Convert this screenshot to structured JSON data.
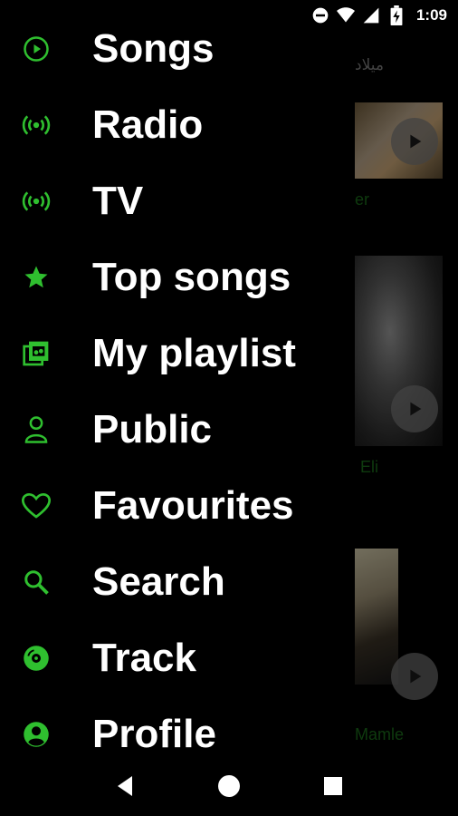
{
  "status_bar": {
    "time": "1:09",
    "icons": [
      "do-not-disturb-icon",
      "wifi-icon",
      "cellular-signal-icon",
      "battery-charging-icon"
    ]
  },
  "background": {
    "header_text": "میلاد",
    "captions": [
      "er",
      "Eli",
      "Mamle"
    ]
  },
  "drawer": {
    "items": [
      {
        "label": "Songs",
        "icon": "play-circle-icon"
      },
      {
        "label": "Radio",
        "icon": "radio-broadcast-icon"
      },
      {
        "label": "TV",
        "icon": "tv-broadcast-icon"
      },
      {
        "label": "Top songs",
        "icon": "star-icon"
      },
      {
        "label": "My playlist",
        "icon": "playlist-library-icon"
      },
      {
        "label": "Public",
        "icon": "person-outline-icon"
      },
      {
        "label": "Favourites",
        "icon": "heart-outline-icon"
      },
      {
        "label": "Search",
        "icon": "search-icon"
      },
      {
        "label": "Track",
        "icon": "disc-icon"
      },
      {
        "label": "Profile",
        "icon": "account-circle-icon"
      }
    ]
  },
  "nav_bar": {
    "icons": [
      "back-icon",
      "home-icon",
      "recents-icon"
    ]
  },
  "colors": {
    "accent": "#2fbf2f",
    "background": "#000000",
    "text": "#ffffff"
  }
}
